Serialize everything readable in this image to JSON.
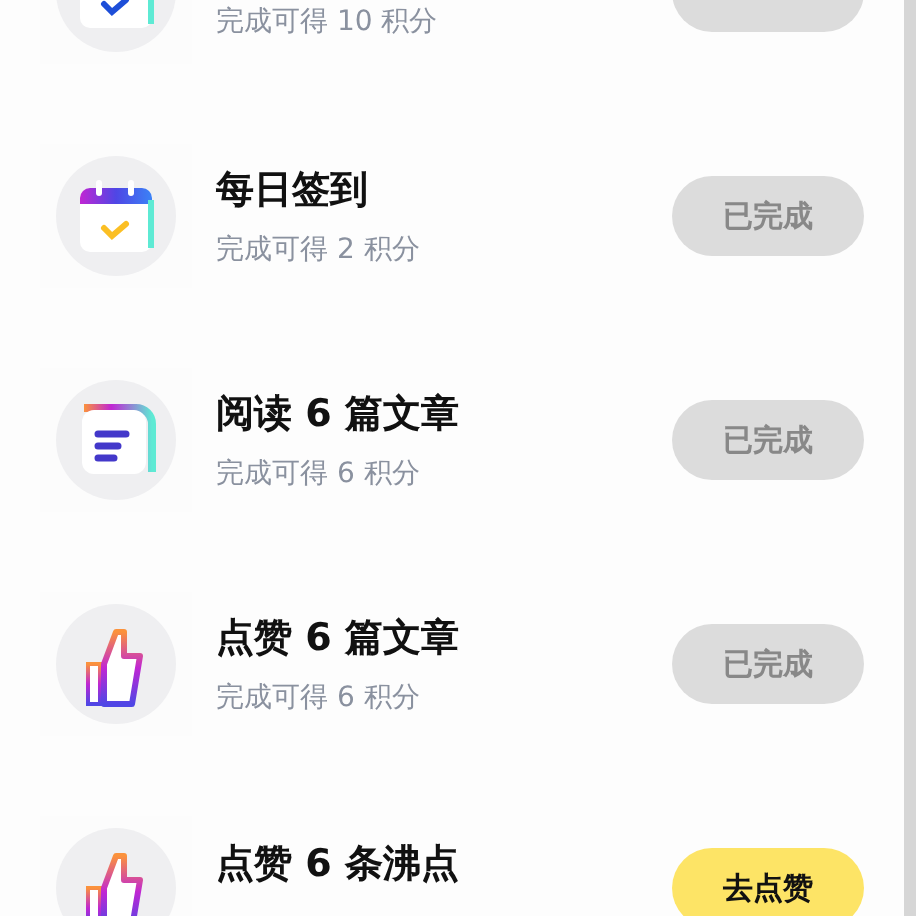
{
  "tasks": [
    {
      "kind": "check-calendar",
      "subtitle": "完成可得 10 积分",
      "done": true
    },
    {
      "kind": "calendar",
      "title": "每日签到",
      "subtitle": "完成可得 2 积分",
      "button": "已完成",
      "done": true
    },
    {
      "kind": "reading",
      "title": "阅读 6 篇文章",
      "subtitle": "完成可得 6 积分",
      "button": "已完成",
      "done": true
    },
    {
      "kind": "like",
      "title": "点赞 6 篇文章",
      "subtitle": "完成可得 6 积分",
      "button": "已完成",
      "done": true
    },
    {
      "kind": "like",
      "title": "点赞 6 条沸点",
      "button": "去点赞",
      "done": false
    }
  ]
}
